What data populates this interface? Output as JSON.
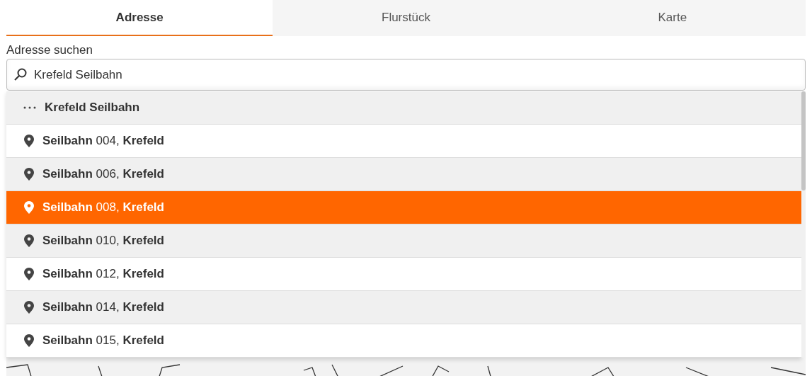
{
  "tabs": [
    {
      "label": "Adresse",
      "selected": true
    },
    {
      "label": "Flurstück",
      "selected": false
    },
    {
      "label": "Karte",
      "selected": false
    }
  ],
  "search": {
    "label": "Adresse suchen",
    "value": "Krefeld Seilbahn"
  },
  "results": [
    {
      "kind": "more",
      "text": "Krefeld Seilbahn",
      "selected": false
    },
    {
      "kind": "address",
      "text": "**Seilbahn** 004, **Krefeld**",
      "selected": false
    },
    {
      "kind": "address",
      "text": "**Seilbahn** 006, **Krefeld**",
      "selected": false
    },
    {
      "kind": "address",
      "text": "**Seilbahn** 008, **Krefeld**",
      "selected": true
    },
    {
      "kind": "address",
      "text": "**Seilbahn** 010, **Krefeld**",
      "selected": false
    },
    {
      "kind": "address",
      "text": "**Seilbahn** 012, **Krefeld**",
      "selected": false
    },
    {
      "kind": "address",
      "text": "**Seilbahn** 014, **Krefeld**",
      "selected": false
    },
    {
      "kind": "address",
      "text": "**Seilbahn** 015, **Krefeld**",
      "selected": false
    }
  ]
}
